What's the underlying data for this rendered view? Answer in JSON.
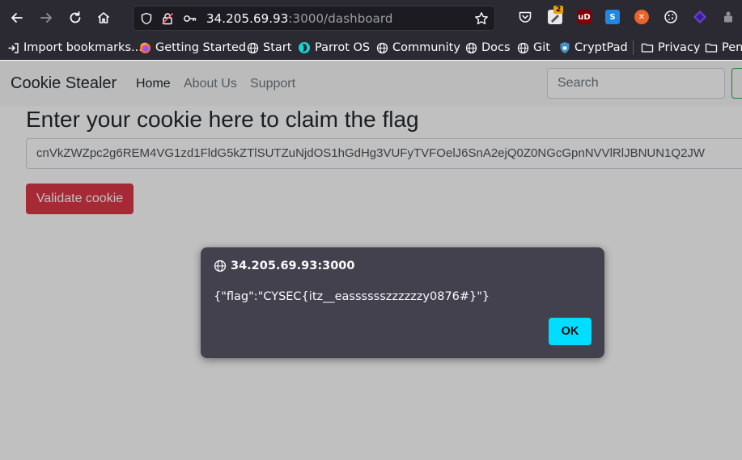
{
  "browser": {
    "url_host": "34.205.69.93",
    "url_path": ":3000/dashboard",
    "extension_badge": "2",
    "bookmarks": [
      {
        "label": "Import bookmarks...",
        "icon": "import-icon"
      },
      {
        "label": "Getting Started",
        "icon": "firefox-icon"
      },
      {
        "label": "Start",
        "icon": "globe-icon"
      },
      {
        "label": "Parrot OS",
        "icon": "parrot-icon"
      },
      {
        "label": "Community",
        "icon": "globe-icon"
      },
      {
        "label": "Docs",
        "icon": "globe-icon"
      },
      {
        "label": "Git",
        "icon": "globe-icon"
      },
      {
        "label": "CryptPad",
        "icon": "cryptpad-icon"
      },
      {
        "label": "Privacy",
        "icon": "folder-icon"
      },
      {
        "label": "Pent",
        "icon": "folder-icon"
      }
    ]
  },
  "navbar": {
    "brand": "Cookie Stealer",
    "links": [
      "Home",
      "About Us",
      "Support"
    ],
    "search_placeholder": "Search"
  },
  "main": {
    "heading": "Enter your cookie here to claim the flag",
    "cookie_value": "cnVkZWZpc2g6REM4VG1zd1FldG5kZTlSUTZuNjdOS1hGdHg3VUFyTVFOelJ6SnA2ejQ0Z0NGcGpnNVVlRlJBNUN1Q2JW",
    "validate_label": "Validate cookie"
  },
  "dialog": {
    "origin": "34.205.69.93:3000",
    "message": "{\"flag\":\"CYSEC{itz__easssssszzzzzzy0876#}\"}",
    "ok_label": "OK"
  },
  "colors": {
    "chrome_bg": "#2b2a33",
    "dialog_bg": "#42414d",
    "ok_accent": "#00ddff",
    "danger": "#dc3545"
  }
}
